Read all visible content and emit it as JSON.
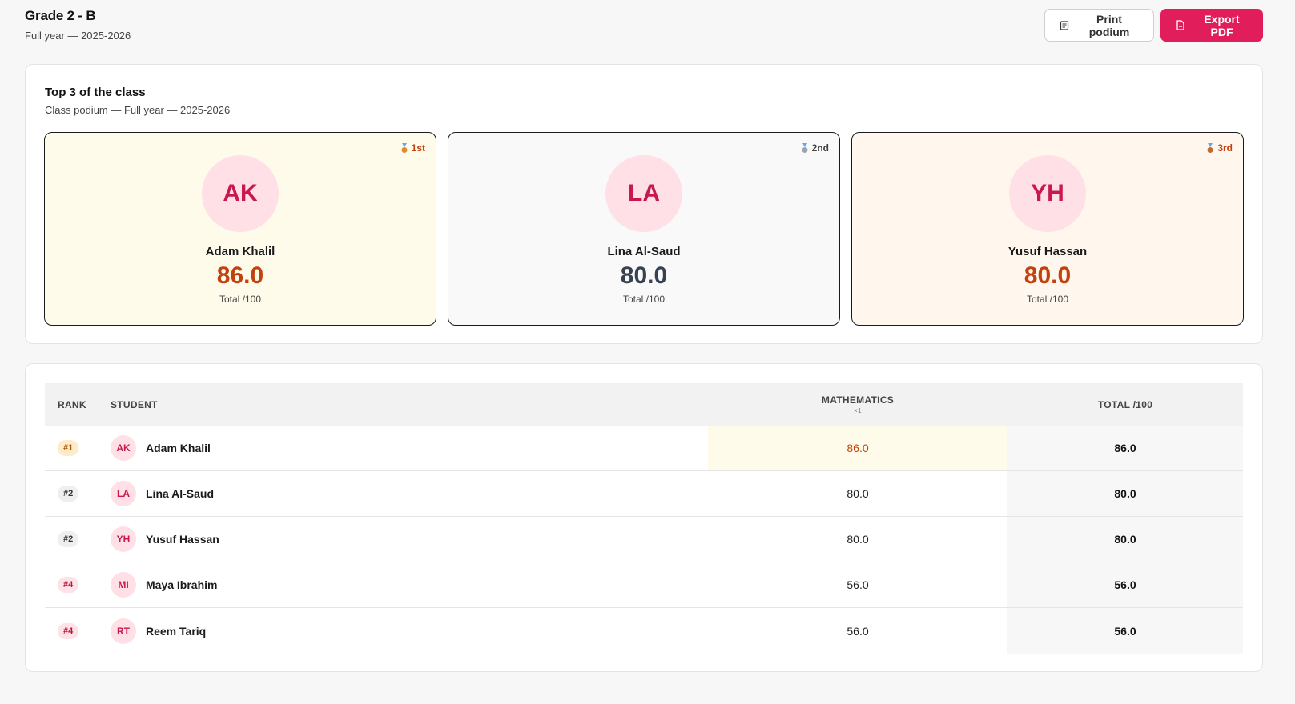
{
  "header": {
    "title": "Grade 2 - B",
    "subtitle": "Full year — 2025-2026",
    "print_label": "Print podium",
    "export_label": "Export PDF"
  },
  "podium": {
    "title": "Top 3 of the class",
    "subtitle": "Class podium — Full year — 2025-2026",
    "entries": [
      {
        "place": "1st",
        "initials": "AK",
        "name": "Adam Khalil",
        "score": "86.0",
        "label": "Total /100"
      },
      {
        "place": "2nd",
        "initials": "LA",
        "name": "Lina Al-Saud",
        "score": "80.0",
        "label": "Total /100"
      },
      {
        "place": "3rd",
        "initials": "YH",
        "name": "Yusuf Hassan",
        "score": "80.0",
        "label": "Total /100"
      }
    ]
  },
  "table": {
    "headers": {
      "rank": "RANK",
      "student": "STUDENT",
      "math": "MATHEMATICS",
      "math_weight": "×1",
      "total": "TOTAL /100"
    },
    "rows": [
      {
        "rank": "#1",
        "initials": "AK",
        "name": "Adam Khalil",
        "math": "86.0",
        "total": "86.0"
      },
      {
        "rank": "#2",
        "initials": "LA",
        "name": "Lina Al-Saud",
        "math": "80.0",
        "total": "80.0"
      },
      {
        "rank": "#2",
        "initials": "YH",
        "name": "Yusuf Hassan",
        "math": "80.0",
        "total": "80.0"
      },
      {
        "rank": "#4",
        "initials": "MI",
        "name": "Maya Ibrahim",
        "math": "56.0",
        "total": "56.0"
      },
      {
        "rank": "#4",
        "initials": "RT",
        "name": "Reem Tariq",
        "math": "56.0",
        "total": "56.0"
      }
    ]
  },
  "colors": {
    "accent": "#e11d5b",
    "avatar_bg": "#ffe0e6",
    "gold_bg": "#fffbeb",
    "bronze_text": "#c2410c"
  },
  "icons": {
    "print": "document-icon",
    "export": "pdf-file-icon",
    "medal": "medal-icon"
  }
}
